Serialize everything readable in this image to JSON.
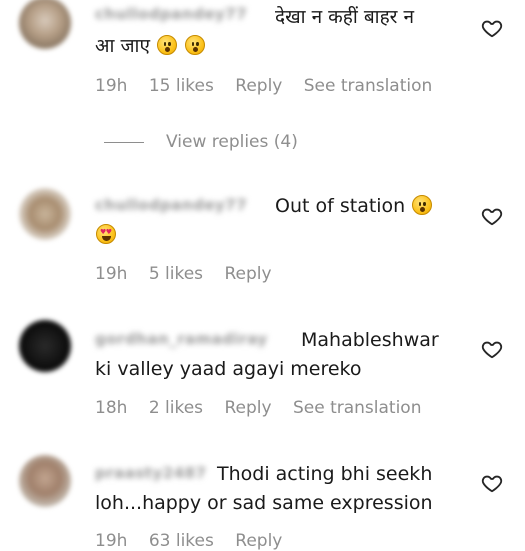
{
  "comments": [
    {
      "username": "chullodpandey77",
      "text_line1": "देखा न कहीं बाहर न",
      "text_line2": "आ जाए",
      "time": "19h",
      "likes": "15 likes",
      "reply": "Reply",
      "translation": "See translation"
    },
    {
      "username": "chullodpandey77",
      "text_line1": "Out of station",
      "time": "19h",
      "likes": "5 likes",
      "reply": "Reply"
    },
    {
      "username": "gordhan_ramadiray",
      "text_line1": "Mahableshwar",
      "text_line2": "ki valley yaad agayi mereko",
      "time": "18h",
      "likes": "2 likes",
      "reply": "Reply",
      "translation": "See translation"
    },
    {
      "username": "praasty2487",
      "text_line1": "Thodi acting bhi seekh",
      "text_line2": "loh...happy or sad same expression",
      "time": "19h",
      "likes": "63 likes",
      "reply": "Reply"
    }
  ],
  "view_replies": "View replies (4)",
  "icons": {
    "like": "heart-outline-icon",
    "emoji_hushed": "hushed-face-emoji",
    "emoji_love": "heart-eyes-emoji"
  },
  "colors": {
    "text": "#262626",
    "meta": "#8e8e8e",
    "background": "#ffffff"
  }
}
